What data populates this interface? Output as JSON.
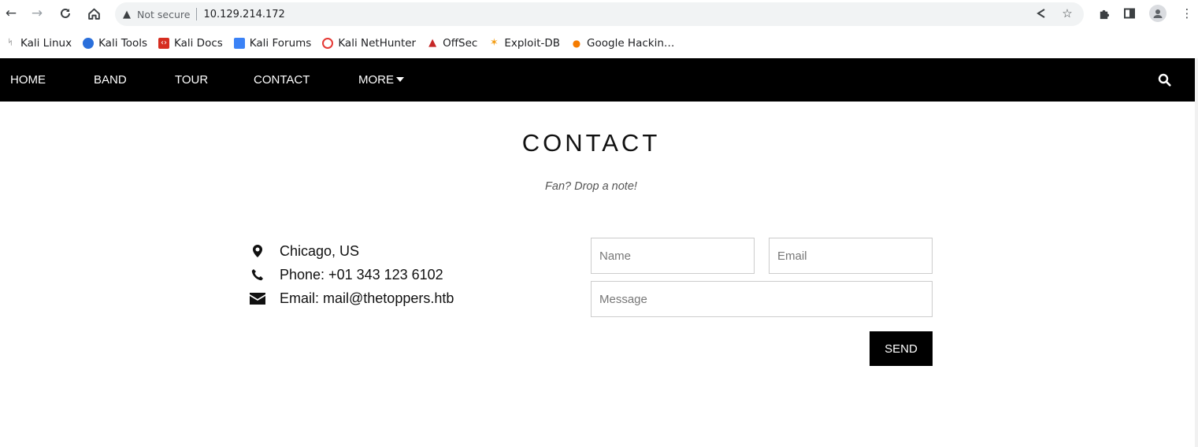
{
  "browser": {
    "address": {
      "security_label": "Not secure",
      "url": "10.129.214.172"
    },
    "bookmarks": [
      {
        "label": "Kali Linux",
        "icon": "kali-dragon-icon",
        "color": "#333333"
      },
      {
        "label": "Kali Tools",
        "icon": "kali-tools-icon",
        "color": "#2a6fdb"
      },
      {
        "label": "Kali Docs",
        "icon": "kali-docs-icon",
        "color": "#d62d20"
      },
      {
        "label": "Kali Forums",
        "icon": "kali-forums-icon",
        "color": "#3b82f6"
      },
      {
        "label": "Kali NetHunter",
        "icon": "kali-nethunter-icon",
        "color": "#e53935"
      },
      {
        "label": "OffSec",
        "icon": "offsec-icon",
        "color": "#c62828"
      },
      {
        "label": "Exploit-DB",
        "icon": "exploit-db-icon",
        "color": "#f39c12"
      },
      {
        "label": "Google Hackin…",
        "icon": "google-hacking-icon",
        "color": "#f57c00"
      }
    ]
  },
  "site_nav": {
    "items": [
      {
        "label": "HOME"
      },
      {
        "label": "BAND"
      },
      {
        "label": "TOUR"
      },
      {
        "label": "CONTACT"
      },
      {
        "label": "MORE"
      }
    ]
  },
  "contact": {
    "title": "CONTACT",
    "subtitle": "Fan? Drop a note!",
    "location": "Chicago, US",
    "phone": "Phone: +01 343 123 6102",
    "email": "Email: mail@thetoppers.htb"
  },
  "form": {
    "name_placeholder": "Name",
    "email_placeholder": "Email",
    "message_placeholder": "Message",
    "send_label": "SEND"
  }
}
